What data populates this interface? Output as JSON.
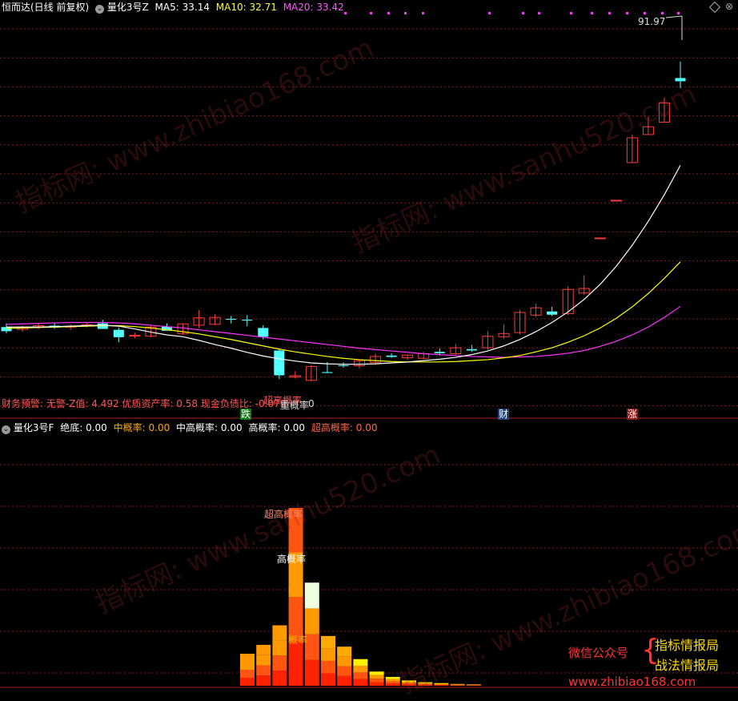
{
  "top_header": {
    "stock_name": "恒而达(日线 前复权)",
    "indicator": "量化3号Z",
    "ma5_label": "MA5:",
    "ma5_value": "33.14",
    "ma10_label": "MA10:",
    "ma10_value": "32.71",
    "ma20_label": "MA20:",
    "ma20_value": "33.42"
  },
  "finance_line": "财务预警: 无警-Z值: 4.492 优质资产率: 0.58 现金负债比: -0.079",
  "markers": {
    "fall": "跌",
    "finance": "财",
    "rise": "涨"
  },
  "overlap_text_a": "超高概率",
  "overlap_text_b": "重概率",
  "overlap_text_c": "0",
  "bottom_header": {
    "indicator": "量化3号F",
    "items": [
      {
        "label": "绝底:",
        "value": "0.00"
      },
      {
        "label": "中概率:",
        "value": "0.00"
      },
      {
        "label": "中高概率:",
        "value": "0.00"
      },
      {
        "label": "高概率:",
        "value": "0.00"
      },
      {
        "label": "超高概率:",
        "value": "0.00"
      }
    ]
  },
  "bar_labels": {
    "super_high": "超高概率",
    "high": "高概率",
    "mid": "概率"
  },
  "watermarks": [
    "指标网: www.zhibiao168.com",
    "指标网: www.sanhu520.com",
    "指标网: www.sanhu520.com",
    "指标网: www.zhibiao168.com"
  ],
  "corner_brand": {
    "wechat": "微信公众号",
    "line1": "指标情报局",
    "line2": "战法情报局",
    "site": "www.zhibiao168.com"
  },
  "colors": {
    "up": "#ff3b3b",
    "down": "#54ffff",
    "ma5": "#ffffff",
    "ma10": "#ffff00",
    "ma20": "#ff33ff",
    "grid": "#8b1a1a",
    "header_ma5": "#ffffff",
    "header_ma10": "#ffff33",
    "header_ma20": "#ff55ff"
  },
  "chart_data": [
    {
      "type": "candlestick",
      "title": "量化3号Z",
      "y_top_label": "91.97",
      "ylim": [
        15,
        98
      ],
      "candles": [
        {
          "o": 31.0,
          "h": 31.8,
          "l": 29.6,
          "c": 30.1
        },
        {
          "o": 30.5,
          "h": 31.3,
          "l": 30.0,
          "c": 31.0
        },
        {
          "o": 31.0,
          "h": 31.8,
          "l": 30.5,
          "c": 31.3
        },
        {
          "o": 31.3,
          "h": 32.0,
          "l": 30.6,
          "c": 30.9
        },
        {
          "o": 31.0,
          "h": 31.6,
          "l": 30.4,
          "c": 31.2
        },
        {
          "o": 31.4,
          "h": 32.1,
          "l": 30.9,
          "c": 31.5
        },
        {
          "o": 31.8,
          "h": 32.6,
          "l": 31.0,
          "c": 30.6
        },
        {
          "o": 30.4,
          "h": 30.9,
          "l": 27.7,
          "c": 28.8
        },
        {
          "o": 29.0,
          "h": 29.8,
          "l": 28.5,
          "c": 29.2
        },
        {
          "o": 29.0,
          "h": 31.3,
          "l": 28.8,
          "c": 31.0
        },
        {
          "o": 31.1,
          "h": 31.8,
          "l": 30.6,
          "c": 30.2
        },
        {
          "o": 29.6,
          "h": 31.8,
          "l": 29.3,
          "c": 31.7
        },
        {
          "o": 31.4,
          "h": 34.7,
          "l": 30.8,
          "c": 33.0
        },
        {
          "o": 31.6,
          "h": 33.8,
          "l": 31.4,
          "c": 33.1
        },
        {
          "o": 32.8,
          "h": 33.4,
          "l": 31.8,
          "c": 32.6
        },
        {
          "o": 32.6,
          "h": 33.6,
          "l": 31.2,
          "c": 32.4
        },
        {
          "o": 30.8,
          "h": 31.4,
          "l": 28.3,
          "c": 28.9
        },
        {
          "o": 25.9,
          "h": 26.3,
          "l": 19.7,
          "c": 20.5
        },
        {
          "o": 20.1,
          "h": 21.4,
          "l": 19.8,
          "c": 20.4
        },
        {
          "o": 19.4,
          "h": 22.8,
          "l": 19.2,
          "c": 22.4
        },
        {
          "o": 21.2,
          "h": 23.4,
          "l": 21.0,
          "c": 21.0
        },
        {
          "o": 22.7,
          "h": 23.3,
          "l": 22.2,
          "c": 22.6
        },
        {
          "o": 22.6,
          "h": 23.9,
          "l": 22.0,
          "c": 23.7
        },
        {
          "o": 23.3,
          "h": 25.2,
          "l": 22.8,
          "c": 24.6
        },
        {
          "o": 24.8,
          "h": 25.3,
          "l": 24.3,
          "c": 24.5
        },
        {
          "o": 24.3,
          "h": 25.0,
          "l": 23.9,
          "c": 24.9
        },
        {
          "o": 24.2,
          "h": 25.6,
          "l": 24.0,
          "c": 25.2
        },
        {
          "o": 25.6,
          "h": 26.4,
          "l": 24.8,
          "c": 25.3
        },
        {
          "o": 25.2,
          "h": 27.3,
          "l": 24.9,
          "c": 26.5
        },
        {
          "o": 26.2,
          "h": 27.1,
          "l": 25.6,
          "c": 25.9
        },
        {
          "o": 26.5,
          "h": 30.1,
          "l": 26.0,
          "c": 29.0
        },
        {
          "o": 28.9,
          "h": 31.6,
          "l": 28.5,
          "c": 29.6
        },
        {
          "o": 29.8,
          "h": 34.8,
          "l": 29.4,
          "c": 34.2
        },
        {
          "o": 33.6,
          "h": 36.1,
          "l": 33.2,
          "c": 35.2
        },
        {
          "o": 34.4,
          "h": 35.4,
          "l": 33.4,
          "c": 33.7
        },
        {
          "o": 33.9,
          "h": 39.9,
          "l": 33.6,
          "c": 39.2
        },
        {
          "o": 38.4,
          "h": 42.3,
          "l": 38.0,
          "c": 39.4
        },
        {
          "o": 50.4,
          "h": 50.4,
          "l": 50.4,
          "c": 50.4
        },
        {
          "o": 58.6,
          "h": 58.6,
          "l": 58.6,
          "c": 58.6
        },
        {
          "o": 66.8,
          "h": 72.9,
          "l": 66.8,
          "c": 72.2
        },
        {
          "o": 72.9,
          "h": 76.8,
          "l": 72.9,
          "c": 74.6
        },
        {
          "o": 75.6,
          "h": 81.0,
          "l": 75.6,
          "c": 79.8
        },
        {
          "o": 85.2,
          "h": 88.8,
          "l": 83.0,
          "c": 84.5
        }
      ],
      "ma5": [
        31.0,
        31.0,
        31.0,
        31.1,
        31.2,
        31.3,
        31.4,
        31.2,
        30.6,
        29.9,
        29.3,
        28.9,
        28.1,
        27.2,
        26.4,
        25.5,
        24.7,
        24.1,
        23.6,
        23.2,
        23.0,
        22.9,
        22.9,
        23.0,
        23.2,
        23.4,
        23.7,
        24.0,
        24.4,
        25.0,
        25.8,
        26.9,
        28.3,
        30.0,
        32.0,
        34.3,
        37.0,
        40.3,
        44.2,
        48.8,
        54.0,
        59.8,
        66.2
      ],
      "ma10": [
        30.7,
        30.8,
        30.9,
        31.0,
        31.1,
        31.2,
        31.3,
        31.3,
        31.1,
        30.8,
        30.4,
        30.0,
        29.5,
        28.9,
        28.3,
        27.6,
        26.9,
        26.2,
        25.6,
        25.1,
        24.6,
        24.2,
        23.9,
        23.7,
        23.5,
        23.4,
        23.4,
        23.4,
        23.5,
        23.7,
        23.9,
        24.3,
        24.8,
        25.6,
        26.5,
        27.7,
        29.1,
        30.8,
        32.9,
        35.4,
        38.3,
        41.6,
        45.2
      ],
      "ma20": [
        31.6,
        31.7,
        31.8,
        31.9,
        32.0,
        32.0,
        32.0,
        31.9,
        31.7,
        31.4,
        31.1,
        30.8,
        30.4,
        30.0,
        29.6,
        29.2,
        28.8,
        28.4,
        28.0,
        27.6,
        27.2,
        26.8,
        26.4,
        26.1,
        25.8,
        25.5,
        25.2,
        25.0,
        24.8,
        24.6,
        24.5,
        24.4,
        24.5,
        24.6,
        24.9,
        25.3,
        25.9,
        26.8,
        27.9,
        29.3,
        31.0,
        33.1,
        35.5
      ]
    },
    {
      "type": "bar",
      "title": "量化3号F",
      "ylim": [
        0,
        100
      ],
      "series": [
        {
          "name": "超高概率",
          "color": "#ff5511"
        },
        {
          "name": "高概率",
          "color": "#eeffdd"
        },
        {
          "name": "概率",
          "color": "#ffaa00"
        }
      ],
      "bars": [
        {
          "h": 18,
          "top": "#ff9900"
        },
        {
          "h": 23,
          "top": "#ff9900"
        },
        {
          "h": 34,
          "top": "#ff9900"
        },
        {
          "h": 100,
          "top": "#ff5511"
        },
        {
          "h": 58,
          "top": "#eeffdd"
        },
        {
          "h": 28,
          "top": "#ffaa00"
        },
        {
          "h": 22,
          "top": "#ffaa00"
        },
        {
          "h": 15,
          "top": "#ffee00"
        },
        {
          "h": 8,
          "top": "#ffee00"
        },
        {
          "h": 5,
          "top": "#ffee00"
        },
        {
          "h": 3,
          "top": "#ffee00"
        },
        {
          "h": 2,
          "top": "#ffee00"
        },
        {
          "h": 1.5,
          "top": "#ffee00"
        },
        {
          "h": 1,
          "top": "#ffee00"
        },
        {
          "h": 0.8,
          "top": "#ffee00"
        }
      ]
    }
  ]
}
